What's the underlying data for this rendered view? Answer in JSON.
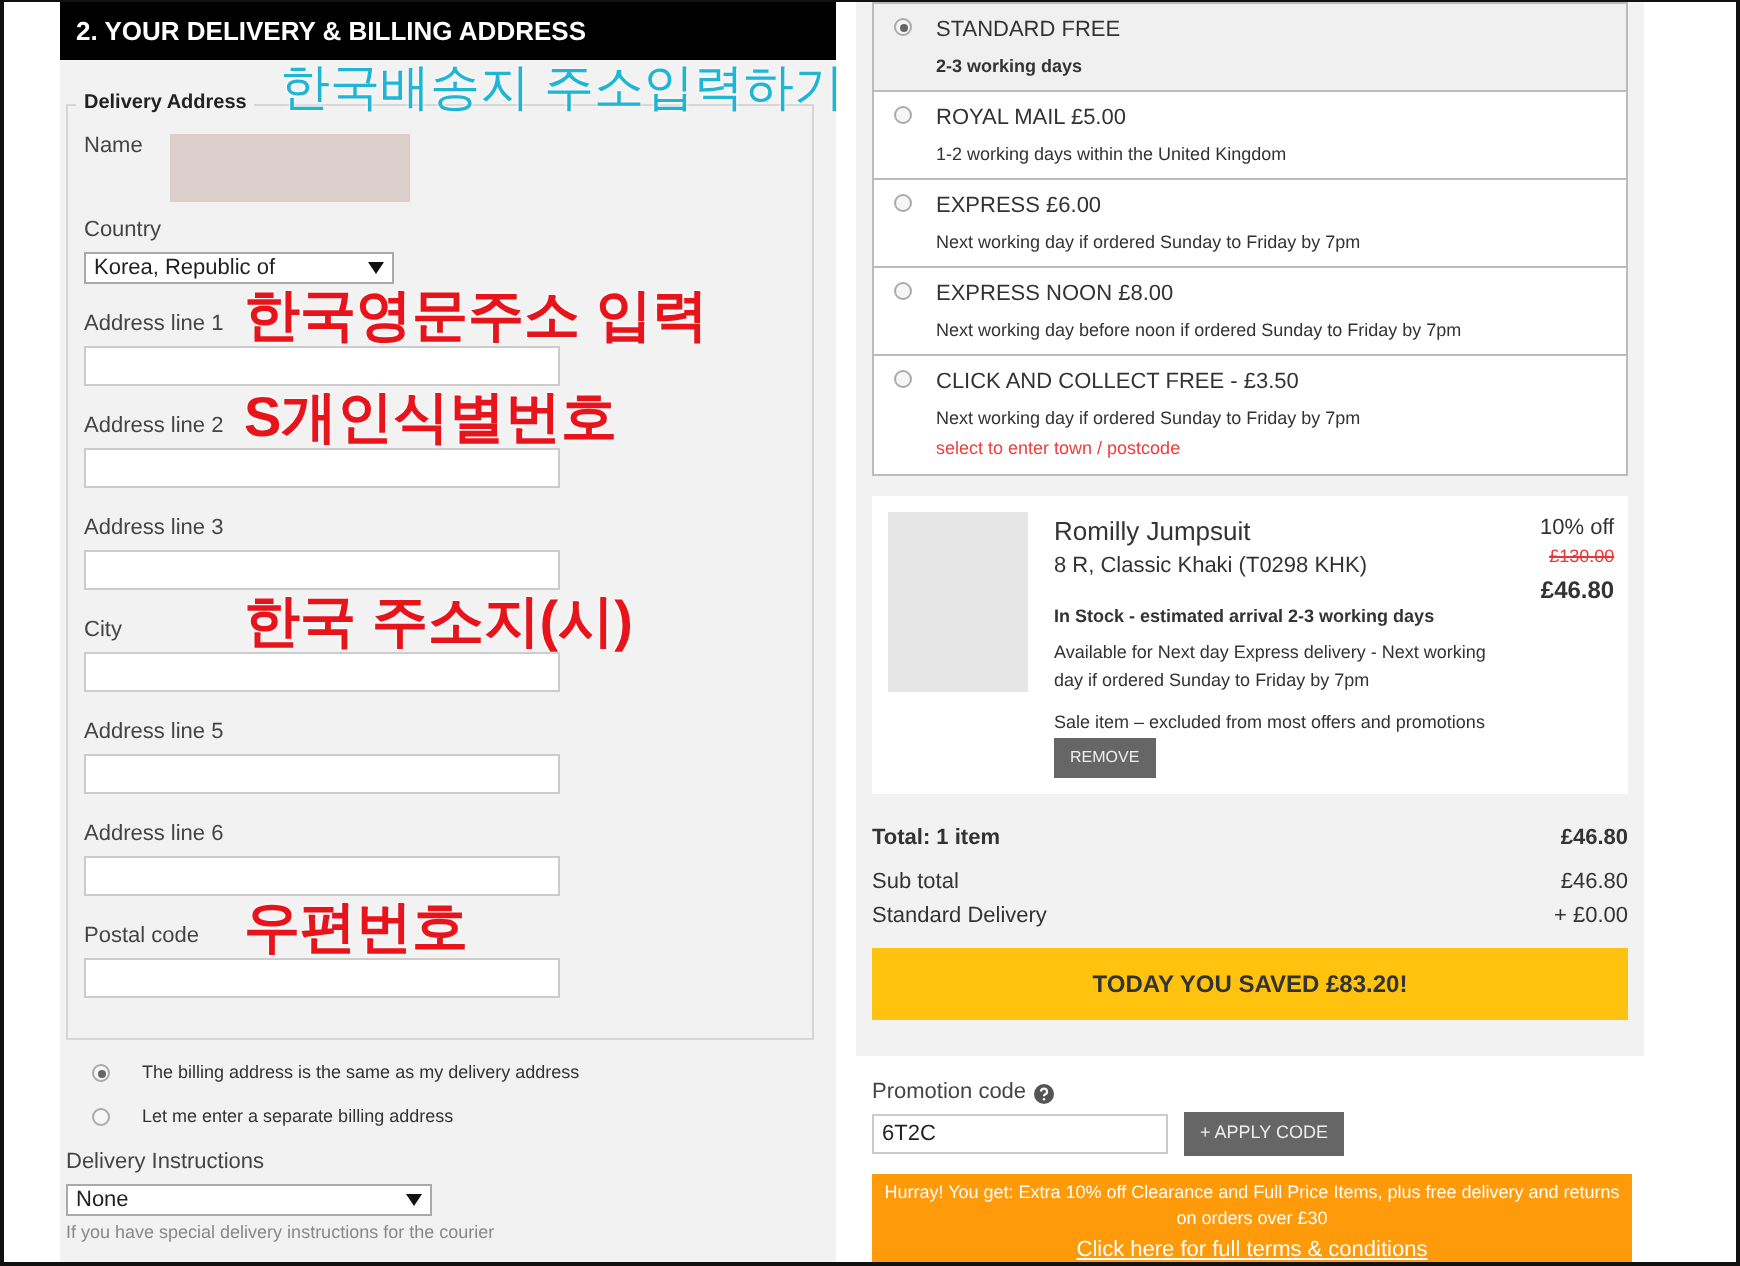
{
  "section_title": "2. YOUR DELIVERY & BILLING ADDRESS",
  "delivery_address": {
    "legend": "Delivery Address",
    "annotation": {
      "text": "한국배송지 주소입력하기",
      "color": "#21b5d5"
    },
    "name_label": "Name",
    "fields": [
      {
        "label": "Country",
        "kind": "select",
        "value": "Korea, Republic of"
      },
      {
        "label": "Address line 1",
        "kind": "text",
        "annotation": {
          "text": "한국영문주소 입력",
          "color": "#e8141c"
        }
      },
      {
        "label": "Address line 2",
        "kind": "text",
        "annotation": {
          "text": "S개인식별번호",
          "color": "#e8141c"
        }
      },
      {
        "label": "Address line 3",
        "kind": "text"
      },
      {
        "label": "City",
        "kind": "text",
        "annotation": {
          "text": "한국 주소지(시)",
          "color": "#e8141c"
        }
      },
      {
        "label": "Address line 5",
        "kind": "text"
      },
      {
        "label": "Address line 6",
        "kind": "text"
      },
      {
        "label": "Postal code",
        "kind": "text",
        "annotation": {
          "text": "우편번호",
          "color": "#e8141c"
        }
      }
    ]
  },
  "billing_options": [
    {
      "label": "The billing address is the same as my delivery address",
      "selected": true
    },
    {
      "label": "Let me enter a separate billing address",
      "selected": false
    }
  ],
  "delivery_instructions": {
    "label": "Delivery Instructions",
    "value": "None",
    "hint": "If you have special delivery instructions for the courier"
  },
  "delivery_methods": [
    {
      "title": "STANDARD FREE",
      "detail": "2-3 working days",
      "selected": true
    },
    {
      "title": "ROYAL MAIL £5.00",
      "detail": "1-2 working days within the United Kingdom",
      "selected": false
    },
    {
      "title": "EXPRESS £6.00",
      "detail": "Next working day if ordered Sunday to Friday by 7pm",
      "selected": false
    },
    {
      "title": "EXPRESS NOON £8.00",
      "detail": "Next working day before noon if ordered Sunday to Friday by 7pm",
      "selected": false
    },
    {
      "title": "CLICK AND COLLECT FREE - £3.50",
      "detail": "Next working day if ordered Sunday to Friday by 7pm",
      "note": "select to enter town / postcode",
      "selected": false
    }
  ],
  "basket_item": {
    "name": "Romilly Jumpsuit",
    "variant": "8 R, Classic Khaki (T0298 KHK)",
    "stock": "In Stock - estimated arrival 2-3 working days",
    "express": "Available for Next day Express delivery - Next working day if ordered Sunday to Friday by 7pm",
    "sale_note": "Sale item – excluded from most offers and promotions",
    "remove_button": "REMOVE",
    "discount": "10% off",
    "old_price": "£130.00",
    "price": "£46.80"
  },
  "totals": {
    "total_label": "Total: 1 item",
    "total_value": "£46.80",
    "rows": [
      {
        "label": "Sub total",
        "value": "£46.80"
      },
      {
        "label": "Standard Delivery",
        "value": "+ £0.00"
      }
    ]
  },
  "savings_banner": "TODAY YOU SAVED £83.20!",
  "promotion": {
    "label": "Promotion code",
    "value": "6T2C",
    "button": "+ APPLY CODE",
    "message": "Hurray! You get: Extra 10% off Clearance and Full Price Items, plus free delivery and returns on orders over £30",
    "link": "Click here for full terms & conditions"
  }
}
